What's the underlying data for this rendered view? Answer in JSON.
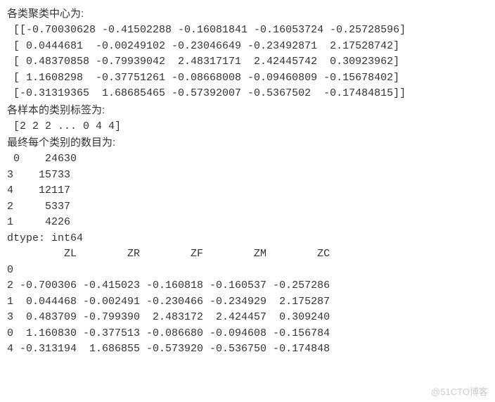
{
  "heading_centers": "各类聚类中心为:",
  "centers": " [[-0.70030628 -0.41502288 -0.16081841 -0.16053724 -0.25728596]\n [ 0.0444681  -0.00249102 -0.23046649 -0.23492871  2.17528742]\n [ 0.48370858 -0.79939042  2.48317171  2.42445742  0.30923962]\n [ 1.1608298  -0.37751261 -0.08668008 -0.09460809 -0.15678402]\n [-0.31319365  1.68685465 -0.57392007 -0.5367502  -0.17484815]]",
  "heading_labels": "各样本的类别标签为:",
  "labels_line": " [2 2 2 ... 0 4 4]",
  "heading_counts": "最终每个类别的数目为:",
  "counts_block": " 0    24630\n3    15733\n4    12117\n2     5337\n1     4226\ndtype: int64",
  "df_block": "         ZL        ZR        ZF        ZM        ZC\n0                                                  \n2 -0.700306 -0.415023 -0.160818 -0.160537 -0.257286\n1  0.044468 -0.002491 -0.230466 -0.234929  2.175287\n3  0.483709 -0.799390  2.483172  2.424457  0.309240\n0  1.160830 -0.377513 -0.086680 -0.094608 -0.156784\n4 -0.313194  1.686855 -0.573920 -0.536750 -0.174848",
  "watermark": "@51CTO博客"
}
